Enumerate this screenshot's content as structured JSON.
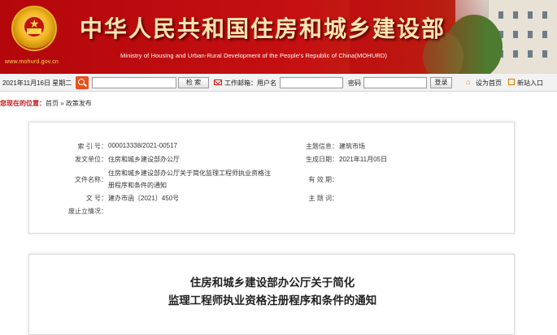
{
  "banner": {
    "site_url": "www.mohurd.gov.cn",
    "title": "中华人民共和国住房和城乡建设部",
    "subtitle": "Ministry of Housing and Urban-Rural Development of the People's Republic of China(MOHURD)"
  },
  "toolbar": {
    "date": "2021年11月16日 星期二",
    "search_label": "检  索",
    "mail_label": "工作邮箱：用户名",
    "password_label": "密码",
    "login_label": "登录",
    "home_label": "设为首页",
    "new_label": "新站入口"
  },
  "breadcrumb": {
    "lead": "您现在的位置：",
    "items": [
      "首页",
      "政策发布"
    ],
    "separator": " » "
  },
  "meta": {
    "index_no_label": "索  引  号：",
    "index_no": "000013338/2021-00517",
    "category_label": "主题信息：",
    "category": "建筑市场",
    "issuer_label": "发文单位：",
    "issuer": "住房和城乡建设部办公厅",
    "date_label": "生成日期：",
    "date": "2021年11月05日",
    "filename_label": "文件名称：",
    "filename_line1": "住房和城乡建设部办公厅关于简化监理工程师执业资格注",
    "filename_line2": "册程序和条件的通知",
    "validity_label": "有  效  期：",
    "validity": "",
    "doc_no_label": "文        号：",
    "doc_no": "建办市函〔2021〕450号",
    "keywords_label": "主  题  词：",
    "keywords": "",
    "repeal_label": "废止立情况："
  },
  "article": {
    "title_line1": "住房和城乡建设部办公厅关于简化",
    "title_line2": "监理工程师执业资格注册程序和条件的通知"
  },
  "colors": {
    "banner_red": "#c61012",
    "title_gold": "#ffe6b0",
    "breadcrumb_red": "#c8161d"
  }
}
